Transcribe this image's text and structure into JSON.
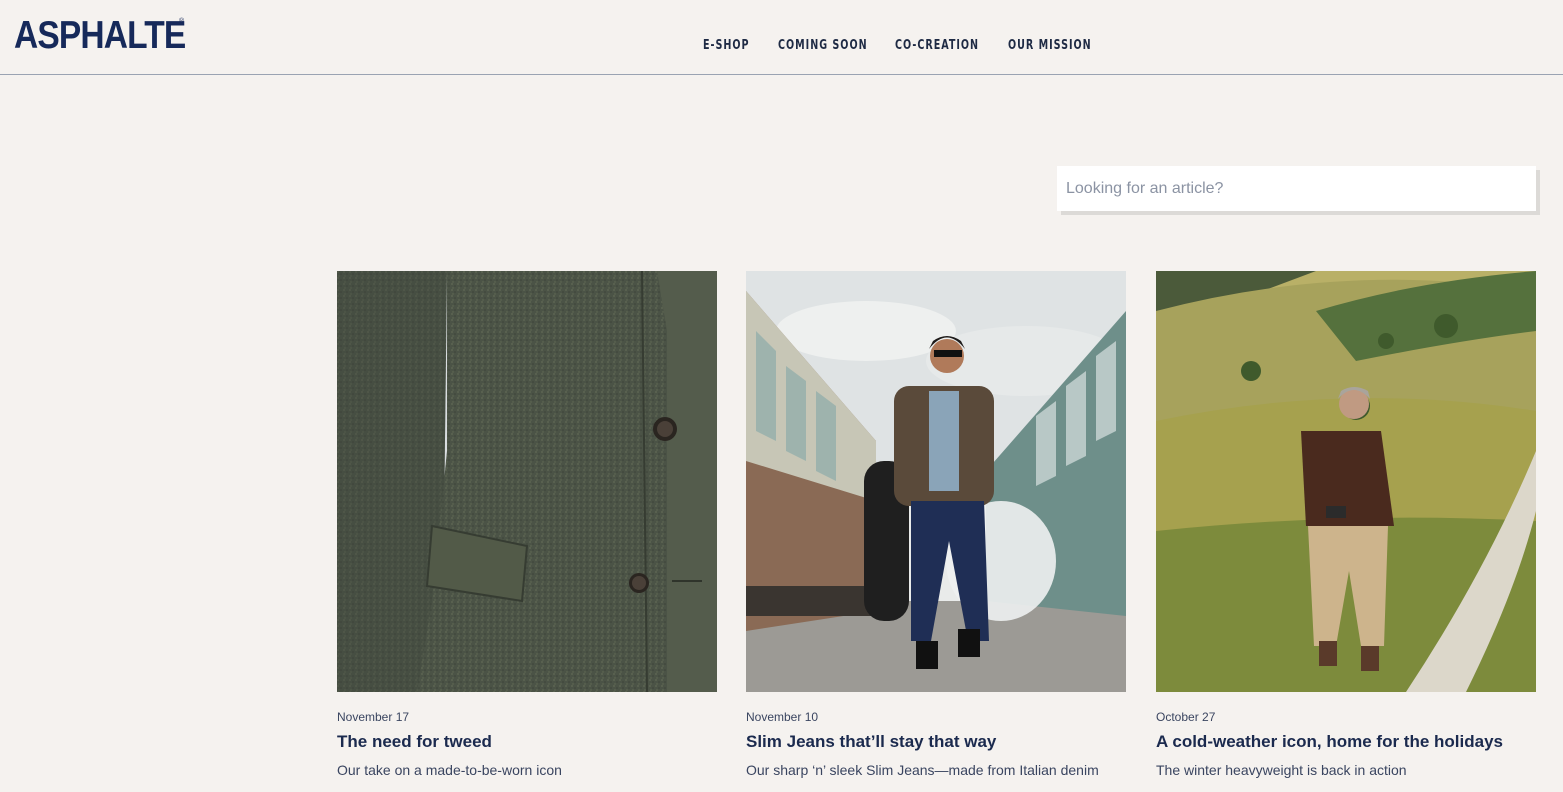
{
  "brand": {
    "logo_text": "ASPHALTE",
    "logo_mark": "®"
  },
  "nav": {
    "items": [
      {
        "label": "E-SHOP"
      },
      {
        "label": "COMING SOON"
      },
      {
        "label": "CO-CREATION"
      },
      {
        "label": "OUR MISSION"
      }
    ]
  },
  "search": {
    "placeholder": "Looking for an article?",
    "value": ""
  },
  "articles": [
    {
      "date": "November 17",
      "title": "The need for tweed",
      "subtitle": "Our take on a made-to-be-worn icon",
      "image": "tweed-jacket-closeup"
    },
    {
      "date": "November 10",
      "title": "Slim Jeans that’ll stay that way",
      "subtitle": "Our sharp ‘n’ sleek Slim Jeans—made from Italian denim",
      "image": "man-walking-between-trains"
    },
    {
      "date": "October 27",
      "title": "A cold-weather icon, home for the holidays",
      "subtitle": "The winter heavyweight is back in action",
      "image": "man-walking-in-meadow"
    }
  ],
  "colors": {
    "background": "#f5f2ef",
    "brand_navy": "#16295a",
    "text": "#1e2a44",
    "muted_text": "#3a4560",
    "divider": "#9aa3b2"
  }
}
